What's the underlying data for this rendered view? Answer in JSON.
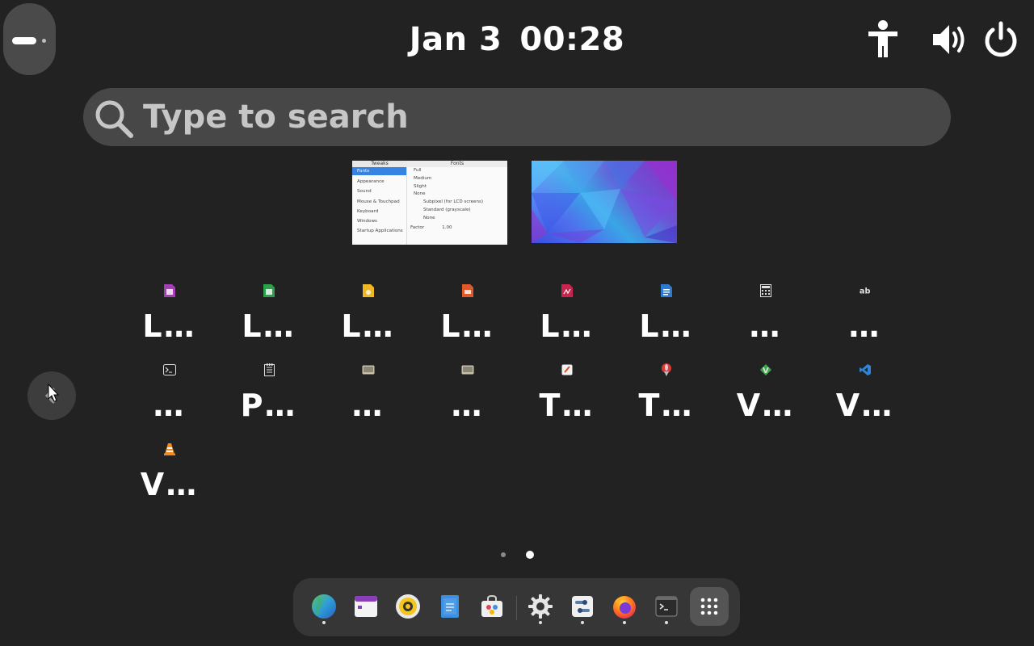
{
  "top_bar": {
    "date": "Jan 3",
    "time": "00:28",
    "accessibility_icon": "accessibility-icon",
    "volume_icon": "volume-icon",
    "power_icon": "power-icon"
  },
  "search": {
    "placeholder": "Type to search",
    "icon": "search-icon"
  },
  "workspaces": {
    "thumb1": {
      "window_title": "Tweaks",
      "panel_title": "Fonts",
      "sidebar": [
        "Fonts",
        "Appearance",
        "Sound",
        "Mouse & Touchpad",
        "Keyboard",
        "Windows",
        "Startup Applications"
      ],
      "lines": [
        "Full",
        "Medium",
        "Slight",
        "None",
        "Subpixel (for LCD screens)",
        "Standard (grayscale)",
        "None",
        "Factor",
        "1.00"
      ]
    },
    "thumb2": {
      "colors": [
        "#3a4de0",
        "#38a6e6",
        "#8a2fc4"
      ]
    }
  },
  "app_grid": {
    "apps": [
      {
        "label": "L…",
        "icon": "libreoffice-base-icon",
        "color": "#a33eb5"
      },
      {
        "label": "L…",
        "icon": "libreoffice-calc-icon",
        "color": "#2aa14a"
      },
      {
        "label": "L…",
        "icon": "libreoffice-draw-icon",
        "color": "#f0b623"
      },
      {
        "label": "L…",
        "icon": "libreoffice-impress-icon",
        "color": "#e0592a"
      },
      {
        "label": "L…",
        "icon": "libreoffice-math-icon",
        "color": "#c7244e"
      },
      {
        "label": "L…",
        "icon": "libreoffice-writer-icon",
        "color": "#2d7ad1"
      },
      {
        "label": "…",
        "icon": "calculator-icon",
        "color": "#e0e0e0"
      },
      {
        "label": "…",
        "icon": "characters-icon",
        "color": "#e0e0e0"
      },
      {
        "label": "…",
        "icon": "terminal-icon",
        "color": "#e0e0e0"
      },
      {
        "label": "P…",
        "icon": "text-editor-icon",
        "color": "#e0e0e0"
      },
      {
        "label": "…",
        "icon": "system-app-icon",
        "color": "#c8c0a8"
      },
      {
        "label": "…",
        "icon": "system-app-icon",
        "color": "#c8c0a8"
      },
      {
        "label": "T…",
        "icon": "notes-icon",
        "color": "#f2f2f2"
      },
      {
        "label": "T…",
        "icon": "transmission-icon",
        "color": "#d93b3b"
      },
      {
        "label": "V…",
        "icon": "vim-icon",
        "color": "#3aa64a"
      },
      {
        "label": "V…",
        "icon": "vscode-icon",
        "color": "#2f86d9"
      },
      {
        "label": "V…",
        "icon": "vlc-icon",
        "color": "#f08a1a"
      }
    ]
  },
  "pagination": {
    "pages": 2,
    "current": 2
  },
  "dash": {
    "items": [
      {
        "icon": "browser-globe-icon",
        "running": true
      },
      {
        "icon": "calendar-icon",
        "running": false
      },
      {
        "icon": "rhythmbox-icon",
        "running": false
      },
      {
        "icon": "text-document-icon",
        "running": false
      },
      {
        "icon": "software-store-icon",
        "running": false
      },
      {
        "icon": "settings-gear-icon",
        "running": true
      },
      {
        "icon": "tweaks-icon",
        "running": true
      },
      {
        "icon": "firefox-icon",
        "running": true
      },
      {
        "icon": "terminal-icon",
        "running": true
      }
    ],
    "show_apps_icon": "app-grid-icon"
  }
}
